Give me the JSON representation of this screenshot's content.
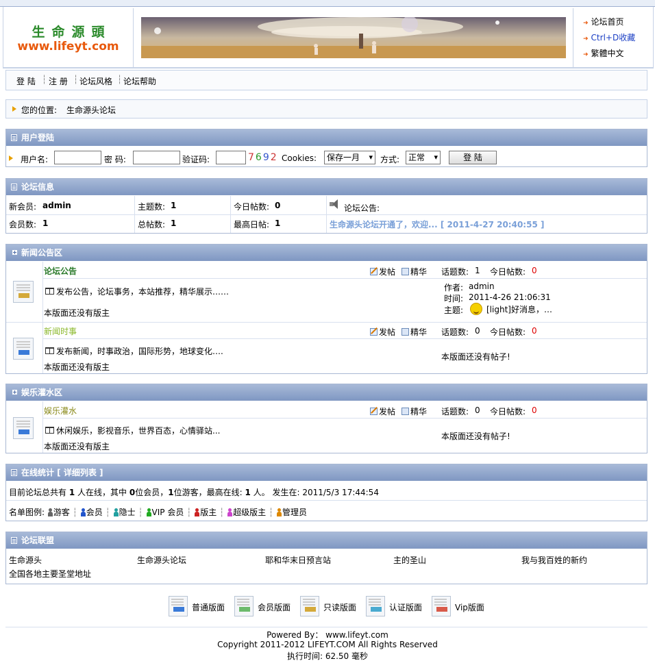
{
  "header": {
    "logo_cn": "生命源頭",
    "logo_en": "www.lifeyt.com",
    "links": [
      {
        "label": "论坛首页",
        "color": "#000000"
      },
      {
        "label": "Ctrl+D收藏",
        "color": "#1a3ec4"
      },
      {
        "label": "繁體中文",
        "color": "#000000"
      }
    ]
  },
  "nav": {
    "items": [
      "登 陆",
      "注 册",
      "论坛风格",
      "论坛帮助"
    ],
    "sep": "┆"
  },
  "location": {
    "label": "您的位置:",
    "value": "生命源头论坛"
  },
  "login": {
    "title": "用户登陆",
    "username_label": "用户名:",
    "password_label": "密 码:",
    "captcha_label": "验证码:",
    "captcha_digits": [
      {
        "d": "7",
        "color": "#cc3333"
      },
      {
        "d": "6",
        "color": "#2a9a2a"
      },
      {
        "d": "9",
        "color": "#3355cc"
      },
      {
        "d": "2",
        "color": "#cc3333"
      }
    ],
    "cookies_label": "Cookies:",
    "cookies_value": "保存一月",
    "mode_label": "方式:",
    "mode_value": "正常",
    "submit": "登 陆"
  },
  "info": {
    "title": "论坛信息",
    "new_member_label": "新会员:",
    "new_member_value": "admin",
    "topics_label": "主题数:",
    "topics_value": "1",
    "today_label": "今日帖数:",
    "today_value": "0",
    "notice_label": "论坛公告:",
    "members_label": "会员数:",
    "members_value": "1",
    "posts_label": "总帖数:",
    "posts_value": "1",
    "max_label": "最高日帖:",
    "max_value": "1",
    "notice_text": "生命源头论坛开通了，欢迎... [ 2011-4-27 20:40:55 ]"
  },
  "news_section": {
    "title": "新闻公告区",
    "forums": [
      {
        "name": "论坛公告",
        "name_color": "#2a7a2a",
        "post": "发帖",
        "digest": "精华",
        "topics_label": "话题数:",
        "topics_value": "1",
        "today_label": "今日帖数:",
        "today_value": "0",
        "desc": "发布公告，论坛事务，本站推荐，精华展示……",
        "moderator": "本版面还没有版主",
        "author_label": "作者:",
        "author": "admin",
        "time_label": "时间:",
        "time": "2011-4-26 21:06:31",
        "subject_label": "主题:",
        "subject": "[light]好消息，…",
        "icon_color": "#d4a93a"
      },
      {
        "name": "新闻时事",
        "name_color": "#8ab82a",
        "post": "发帖",
        "digest": "精华",
        "topics_label": "话题数:",
        "topics_value": "0",
        "today_label": "今日帖数:",
        "today_value": "0",
        "desc": "发布新闻，时事政治，国际形势，地球变化….",
        "moderator": "本版面还没有版主",
        "no_posts": "本版面还没有帖子!",
        "icon_color": "#3a7ad8"
      }
    ]
  },
  "ent_section": {
    "title": "娱乐灌水区",
    "forums": [
      {
        "name": "娱乐灌水",
        "name_color": "#8a8a1a",
        "post": "发帖",
        "digest": "精华",
        "topics_label": "话题数:",
        "topics_value": "0",
        "today_label": "今日帖数:",
        "today_value": "0",
        "desc": "休闲娱乐，影视音乐，世界百态，心情驿站...",
        "moderator": "本版面还没有版主",
        "no_posts": "本版面还没有帖子!",
        "icon_color": "#3a7ad8"
      }
    ]
  },
  "online": {
    "title": "在线统计 [ 详细列表 ]",
    "t1": "目前论坛总共有",
    "n1": "1",
    "t2": "人在线，其中",
    "n2": "0",
    "t3": "位会员，",
    "n3": "1",
    "t4": "位游客，最高在线:",
    "n4": "1",
    "t5": "人。 发生在: 2011/5/3 17:44:54",
    "legend_label": "名单图例:",
    "legend": [
      {
        "label": "游客",
        "color": "#666666"
      },
      {
        "label": "会员",
        "color": "#2255cc"
      },
      {
        "label": "隐士",
        "color": "#22a0a0"
      },
      {
        "label": "VIP 会员",
        "color": "#22aa22"
      },
      {
        "label": "版主",
        "color": "#cc2222"
      },
      {
        "label": "超级版主",
        "color": "#cc44cc"
      },
      {
        "label": "管理员",
        "color": "#dd8800"
      }
    ]
  },
  "alliance": {
    "title": "论坛联盟",
    "links": [
      "生命源头",
      "生命源头论坛",
      "耶和华末日预言站",
      "主的圣山",
      "我与我百姓的新约",
      "全国各地主要圣堂地址"
    ]
  },
  "forum_legend": [
    {
      "label": "普通版面",
      "color": "#3a7ad8"
    },
    {
      "label": "会员版面",
      "color": "#6cba6c"
    },
    {
      "label": "只读版面",
      "color": "#d4a93a"
    },
    {
      "label": "认证版面",
      "color": "#4aaad0"
    },
    {
      "label": "Vip版面",
      "color": "#d85a4a"
    }
  ],
  "footer": {
    "line1": "Powered By：  www.lifeyt.com",
    "line2": "Copyright 2011-2012 LIFEYT.COM All Rights Reserved",
    "line3": "执行时间: 62.50 毫秒"
  }
}
